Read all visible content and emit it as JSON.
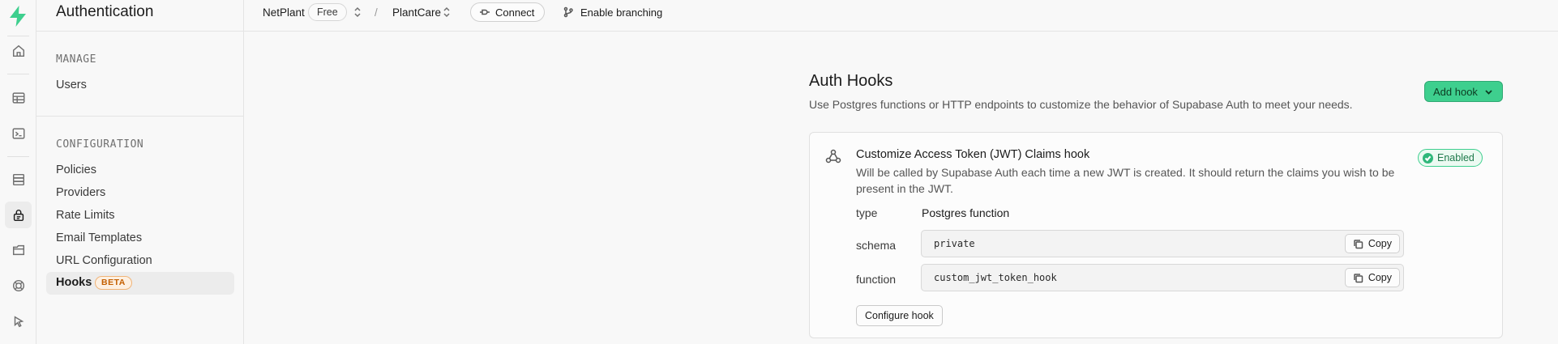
{
  "app": {
    "section_title": "Authentication",
    "brand_color": "#3ecf8e"
  },
  "topbar": {
    "org": "NetPlant",
    "plan": "Free",
    "separator": "/",
    "project": "PlantCare",
    "connect_label": "Connect",
    "branching_label": "Enable branching"
  },
  "rail": {
    "icons": [
      "home-icon",
      "table-editor-icon",
      "sql-editor-icon",
      "database-icon",
      "auth-icon",
      "storage-icon",
      "realtime-icon",
      "pointer-icon"
    ],
    "active": "auth-icon"
  },
  "sidebar": {
    "manage_label": "MANAGE",
    "manage_items": [
      "Users"
    ],
    "config_label": "CONFIGURATION",
    "config_items": [
      "Policies",
      "Providers",
      "Rate Limits",
      "Email Templates",
      "URL Configuration"
    ],
    "active_item": "Hooks",
    "active_badge": "BETA"
  },
  "main": {
    "title": "Auth Hooks",
    "description": "Use Postgres functions or HTTP endpoints to customize the behavior of Supabase Auth to meet your needs.",
    "add_hook_label": "Add hook"
  },
  "hook_card": {
    "title": "Customize Access Token (JWT) Claims hook",
    "description": "Will be called by Supabase Auth each time a new JWT is created. It should return the claims you wish to be present in the JWT.",
    "status": "Enabled",
    "type_key": "type",
    "type_value": "Postgres function",
    "schema_key": "schema",
    "schema_value": "private",
    "function_key": "function",
    "function_value": "custom_jwt_token_hook",
    "copy_label": "Copy",
    "configure_label": "Configure hook"
  }
}
